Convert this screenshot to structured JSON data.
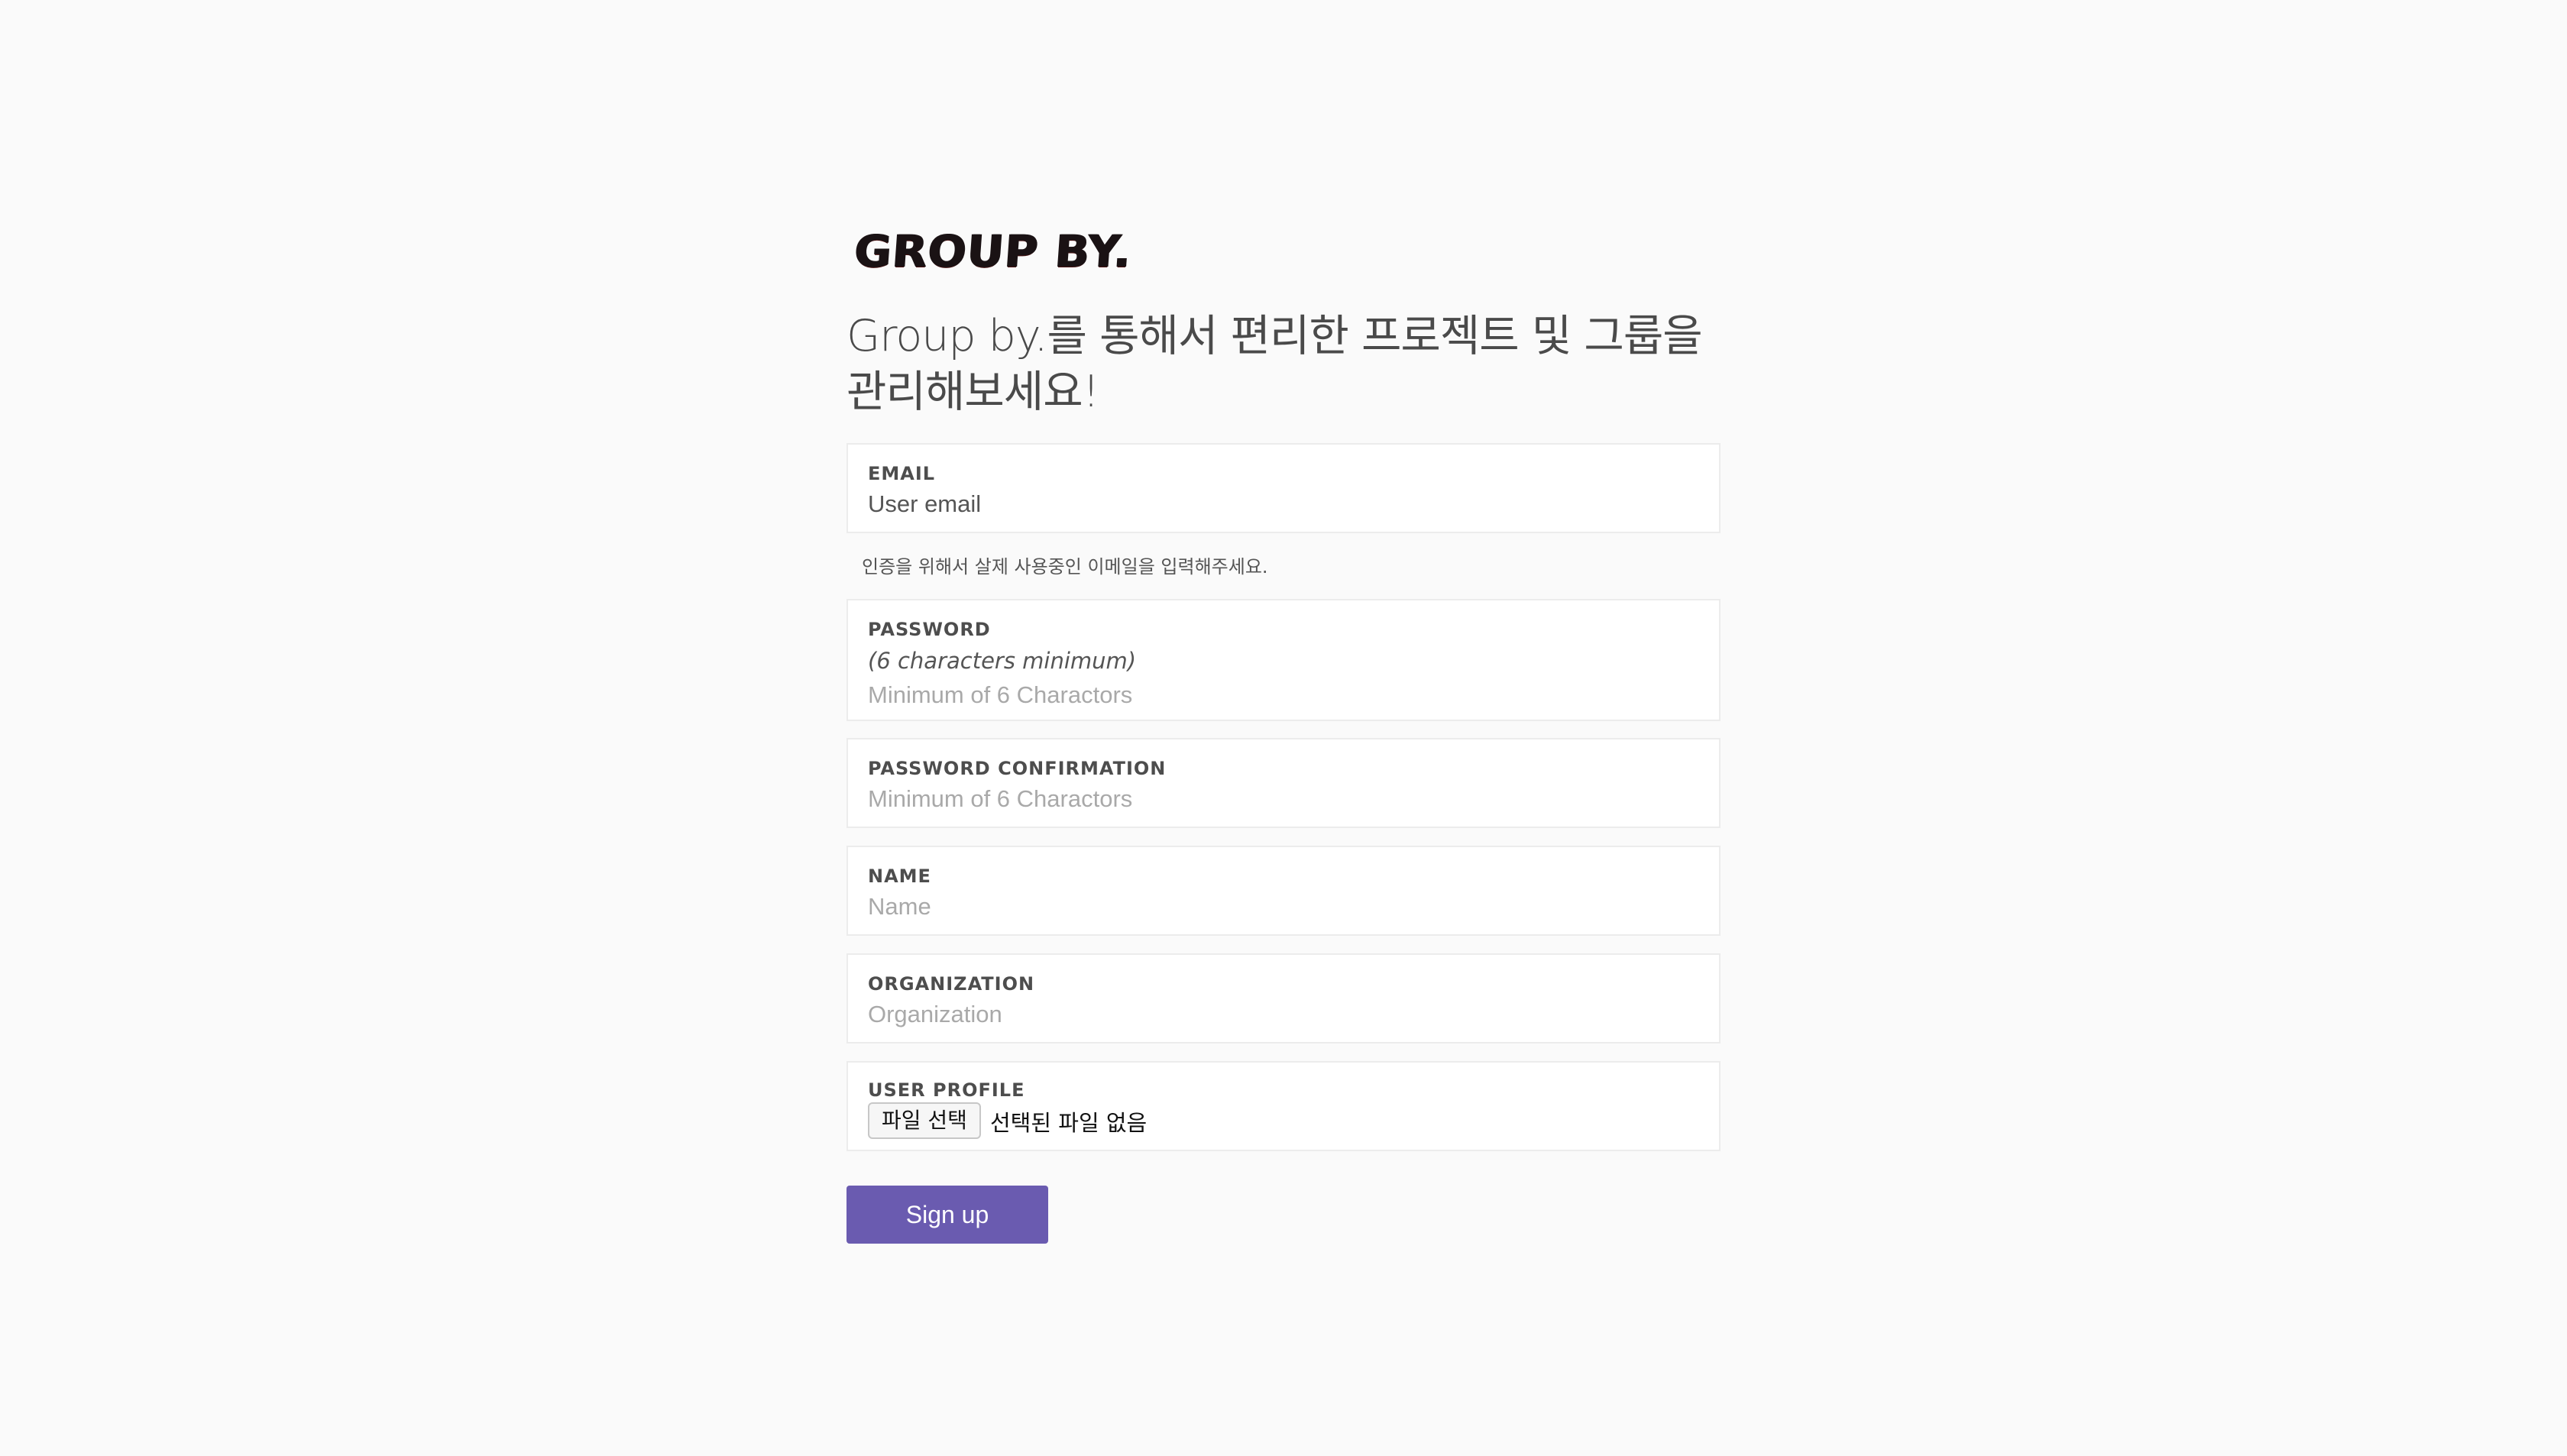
{
  "logo_text": "GROUP BY.",
  "headline_line1": "Group by.를 통해서 편리한 프로젝트 및 그룹을",
  "headline_line2": "관리해보세요!",
  "form": {
    "email": {
      "label": "EMAIL",
      "value": "User email",
      "placeholder": "User email"
    },
    "email_helper": "인증을 위해서 살제 사용중인 이메일을 입력해주세요.",
    "password": {
      "label": "PASSWORD",
      "hint": "(6 characters minimum)",
      "placeholder": "Minimum of 6 Charactors"
    },
    "password_confirmation": {
      "label": "PASSWORD CONFIRMATION",
      "placeholder": "Minimum of 6 Charactors"
    },
    "name": {
      "label": "NAME",
      "placeholder": "Name"
    },
    "organization": {
      "label": "ORGANIZATION",
      "placeholder": "Organization"
    },
    "user_profile": {
      "label": "USER PROFILE",
      "button_label": "파일 선택",
      "status": "선택된 파일 없음"
    },
    "submit_label": "Sign up"
  },
  "colors": {
    "background": "#fafafa",
    "primary_button": "#6a5bb0",
    "field_border": "#ececec"
  }
}
